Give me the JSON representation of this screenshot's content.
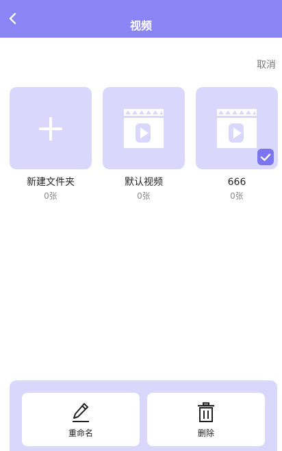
{
  "header": {
    "title": "视频",
    "back_icon": "chevron-left-icon",
    "background": "#8a85f5"
  },
  "toolbar": {
    "cancel_label": "取消"
  },
  "folders": [
    {
      "name": "新建文件夹",
      "count": "0张",
      "icon": "plus-icon",
      "selected": false
    },
    {
      "name": "默认视频",
      "count": "0张",
      "icon": "video-clapper-icon",
      "selected": false
    },
    {
      "name": "666",
      "count": "0张",
      "icon": "video-clapper-icon",
      "selected": true
    }
  ],
  "actions": {
    "rename_label": "重命名",
    "rename_icon": "pencil-icon",
    "delete_label": "删除",
    "delete_icon": "trash-icon"
  },
  "colors": {
    "accent": "#8a85f5",
    "tile": "#d9d7fb",
    "check": "#7b75ef"
  }
}
